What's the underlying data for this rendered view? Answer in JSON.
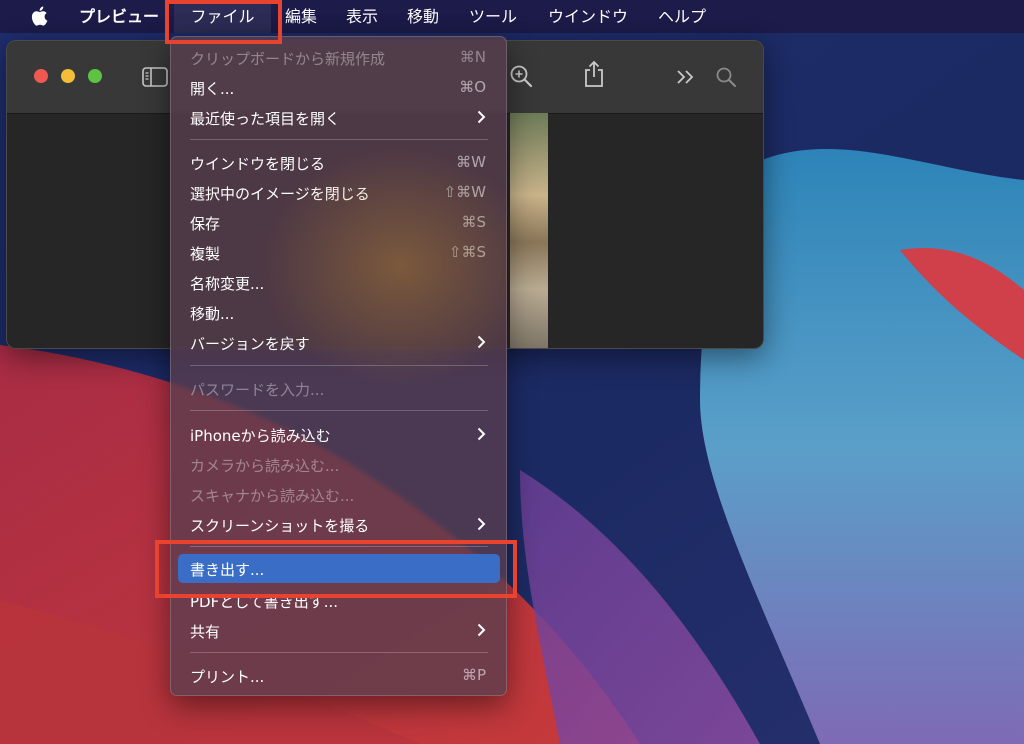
{
  "menubar": {
    "app": "プレビュー",
    "items": [
      "ファイル",
      "編集",
      "表示",
      "移動",
      "ツール",
      "ウインドウ",
      "ヘルプ"
    ]
  },
  "file_menu": {
    "new_from_clipboard": "クリップボードから新規作成",
    "new_from_clipboard_shortcut": "⌘N",
    "open": "開く...",
    "open_shortcut": "⌘O",
    "open_recent": "最近使った項目を開く",
    "close_window": "ウインドウを閉じる",
    "close_window_shortcut": "⌘W",
    "close_selected": "選択中のイメージを閉じる",
    "close_selected_shortcut": "⇧⌘W",
    "save": "保存",
    "save_shortcut": "⌘S",
    "duplicate": "複製",
    "duplicate_shortcut": "⇧⌘S",
    "rename": "名称変更...",
    "move": "移動...",
    "revert": "バージョンを戻す",
    "enter_password": "パスワードを入力...",
    "import_iphone": "iPhoneから読み込む",
    "import_camera": "カメラから読み込む...",
    "import_scanner": "スキャナから読み込む...",
    "screenshot": "スクリーンショットを撮る",
    "export": "書き出す...",
    "export_pdf": "PDFとして書き出す...",
    "share": "共有",
    "print": "プリント...",
    "print_shortcut": "⌘P"
  },
  "colors": {
    "highlight": "#e8432f",
    "selection": "#3a6ec6"
  }
}
